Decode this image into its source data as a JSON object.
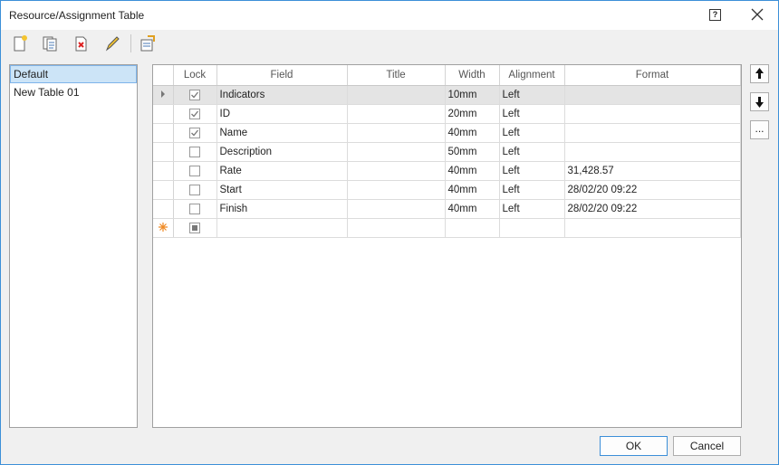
{
  "window": {
    "title": "Resource/Assignment Table",
    "help_glyph": "?"
  },
  "toolbar": {
    "buttons": [
      "new-table-icon",
      "copy-table-icon",
      "delete-table-icon",
      "rename-icon",
      "properties-icon"
    ]
  },
  "table_list": {
    "items": [
      {
        "label": "Default",
        "selected": true
      },
      {
        "label": "New Table 01",
        "selected": false
      }
    ]
  },
  "grid": {
    "columns": [
      "Lock",
      "Field",
      "Title",
      "Width",
      "Alignment",
      "Format"
    ],
    "rows": [
      {
        "lock": "checked",
        "field": "Indicators",
        "title": "",
        "width": "10mm",
        "alignment": "Left",
        "format": ""
      },
      {
        "lock": "checked",
        "field": "ID",
        "title": "",
        "width": "20mm",
        "alignment": "Left",
        "format": ""
      },
      {
        "lock": "checked",
        "field": "Name",
        "title": "",
        "width": "40mm",
        "alignment": "Left",
        "format": ""
      },
      {
        "lock": "unchecked",
        "field": "Description",
        "title": "",
        "width": "50mm",
        "alignment": "Left",
        "format": ""
      },
      {
        "lock": "unchecked",
        "field": "Rate",
        "title": "",
        "width": "40mm",
        "alignment": "Left",
        "format": "31,428.57"
      },
      {
        "lock": "unchecked",
        "field": "Start",
        "title": "",
        "width": "40mm",
        "alignment": "Left",
        "format": "28/02/20 09:22"
      },
      {
        "lock": "unchecked",
        "field": "Finish",
        "title": "",
        "width": "40mm",
        "alignment": "Left",
        "format": "28/02/20 09:22"
      }
    ]
  },
  "side_buttons": {
    "more_label": "..."
  },
  "buttons": {
    "ok": "OK",
    "cancel": "Cancel"
  },
  "colors": {
    "accent": "#3c8fd8",
    "selection": "#cce4f7",
    "new_row_star": "#f08a24"
  }
}
